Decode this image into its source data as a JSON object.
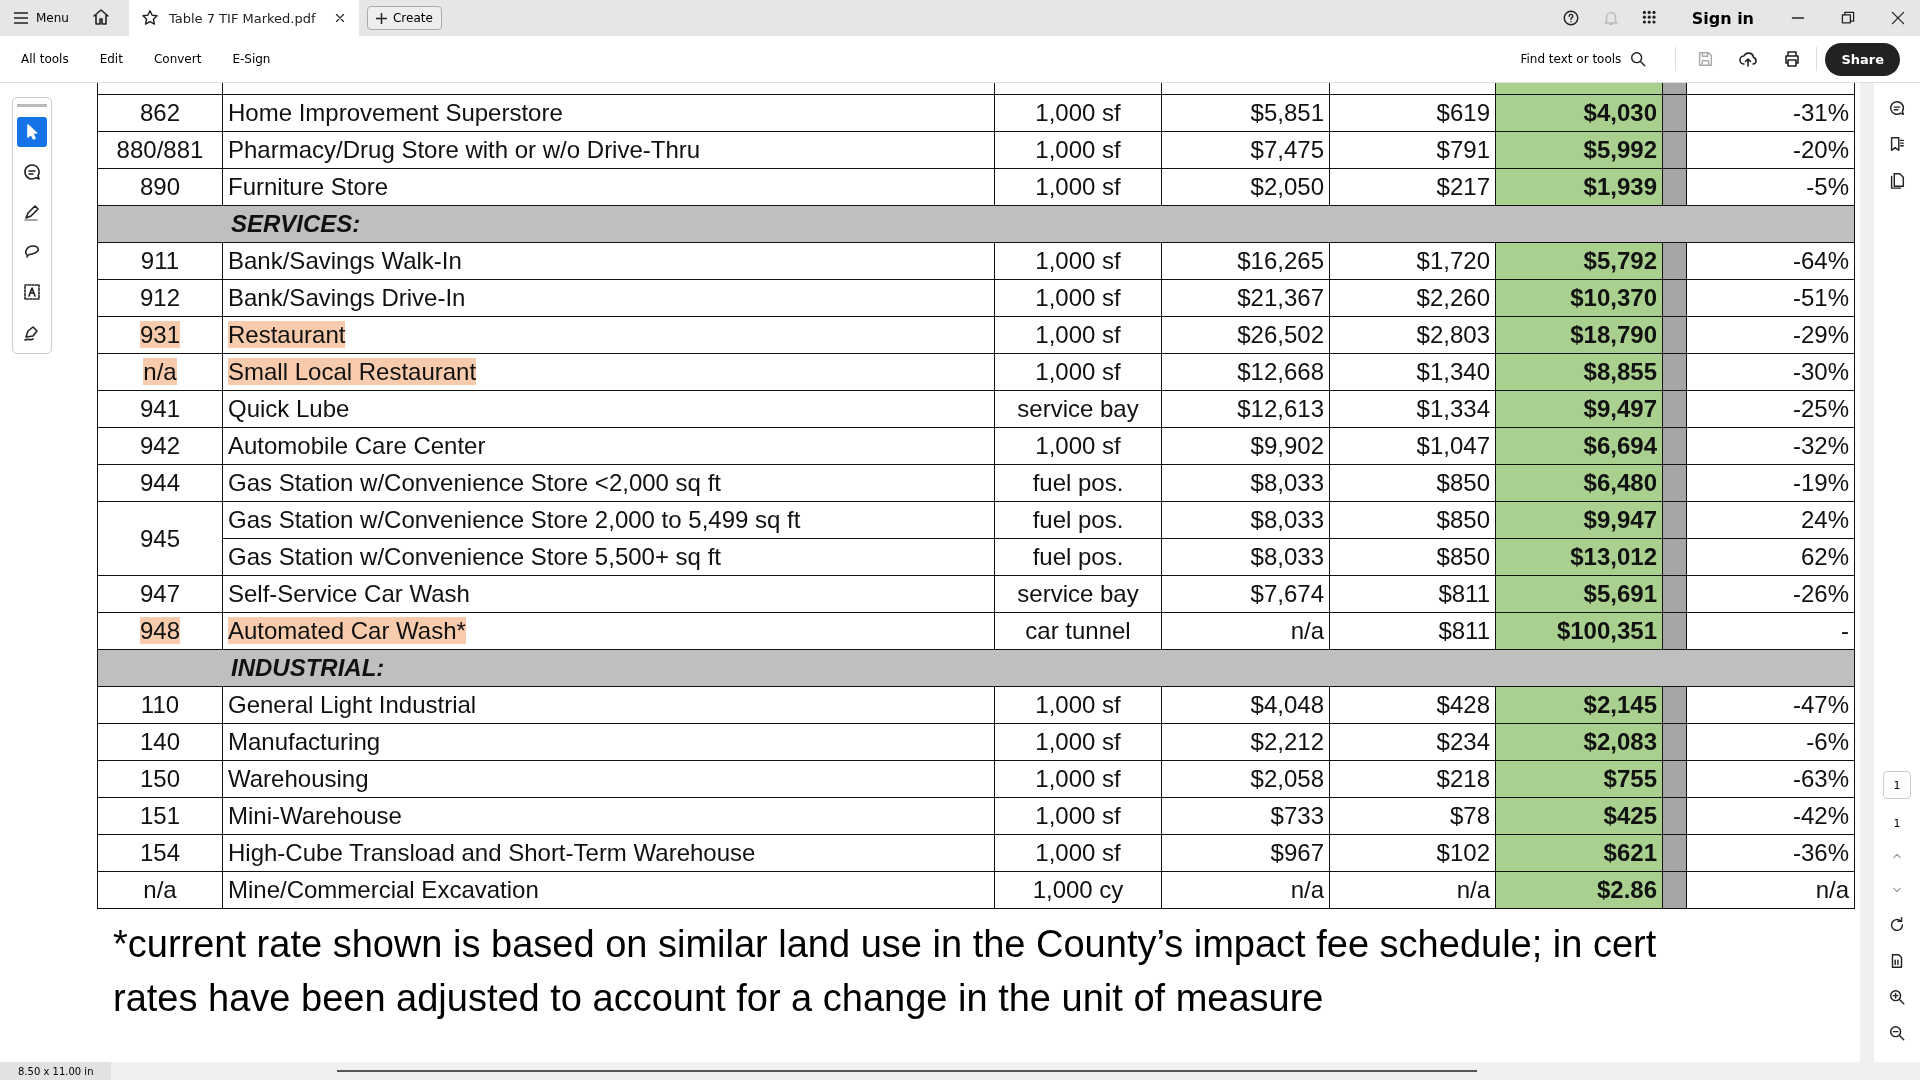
{
  "titlebar": {
    "menu": "Menu",
    "tab": {
      "title": "Table 7 TIF Marked.pdf",
      "selected": true
    },
    "create": "Create",
    "sign_in": "Sign in"
  },
  "toolbar": {
    "items": [
      "All tools",
      "Edit",
      "Convert",
      "E-Sign"
    ],
    "search": "Find text or tools",
    "share": "Share"
  },
  "rail_tools": [
    {
      "kind": "select",
      "selected": true
    },
    {
      "kind": "comment",
      "selected": false
    },
    {
      "kind": "draw",
      "selected": false
    },
    {
      "kind": "lasso",
      "selected": false
    },
    {
      "kind": "text",
      "selected": false
    },
    {
      "kind": "sign",
      "selected": false
    }
  ],
  "table": {
    "rows": [
      {
        "kind": "row",
        "code": "862",
        "description": "Home Improvement Superstore",
        "unit": "1,000 sf",
        "column_4": "$5,851",
        "column_5": "$619",
        "column_6": "$4,030",
        "column_8": "-31%",
        "highlighted": false
      },
      {
        "kind": "row",
        "code": "880/881",
        "description": "Pharmacy/Drug Store with or w/o Drive-Thru",
        "unit": "1,000 sf",
        "column_4": "$7,475",
        "column_5": "$791",
        "column_6": "$5,992",
        "column_8": "-20%",
        "highlighted": false
      },
      {
        "kind": "row",
        "code": "890",
        "description": "Furniture Store",
        "unit": "1,000 sf",
        "column_4": "$2,050",
        "column_5": "$217",
        "column_6": "$1,939",
        "column_8": "-5%",
        "highlighted": false
      },
      {
        "kind": "section",
        "title": "SERVICES:"
      },
      {
        "kind": "row",
        "code": "911",
        "description": "Bank/Savings Walk-In",
        "unit": "1,000 sf",
        "column_4": "$16,265",
        "column_5": "$1,720",
        "column_6": "$5,792",
        "column_8": "-64%",
        "highlighted": false
      },
      {
        "kind": "row",
        "code": "912",
        "description": "Bank/Savings Drive-In",
        "unit": "1,000 sf",
        "column_4": "$21,367",
        "column_5": "$2,260",
        "column_6": "$10,370",
        "column_8": "-51%",
        "highlighted": false
      },
      {
        "kind": "row",
        "code": "931",
        "description": "Restaurant",
        "unit": "1,000 sf",
        "column_4": "$26,502",
        "column_5": "$2,803",
        "column_6": "$18,790",
        "column_8": "-29%",
        "highlighted": true
      },
      {
        "kind": "row",
        "code": "n/a",
        "description": "Small Local Restaurant",
        "unit": "1,000 sf",
        "column_4": "$12,668",
        "column_5": "$1,340",
        "column_6": "$8,855",
        "column_8": "-30%",
        "highlighted": true
      },
      {
        "kind": "row",
        "code": "941",
        "description": "Quick Lube",
        "unit": "service bay",
        "column_4": "$12,613",
        "column_5": "$1,334",
        "column_6": "$9,497",
        "column_8": "-25%",
        "highlighted": false
      },
      {
        "kind": "row",
        "code": "942",
        "description": "Automobile Care Center",
        "unit": "1,000 sf",
        "column_4": "$9,902",
        "column_5": "$1,047",
        "column_6": "$6,694",
        "column_8": "-32%",
        "highlighted": false
      },
      {
        "kind": "row",
        "code": "944",
        "description": "Gas Station w/Convenience Store <2,000 sq ft",
        "unit": "fuel pos.",
        "column_4": "$8,033",
        "column_5": "$850",
        "column_6": "$6,480",
        "column_8": "-19%",
        "highlighted": false
      },
      {
        "kind": "group",
        "code": "945",
        "highlighted": false,
        "lines": [
          {
            "description": "Gas Station w/Convenience Store 2,000 to 5,499 sq ft",
            "unit": "fuel pos.",
            "column_4": "$8,033",
            "column_5": "$850",
            "column_6": "$9,947",
            "column_8": "24%"
          },
          {
            "description": "Gas Station w/Convenience Store 5,500+ sq ft",
            "unit": "fuel pos.",
            "column_4": "$8,033",
            "column_5": "$850",
            "column_6": "$13,012",
            "column_8": "62%"
          }
        ]
      },
      {
        "kind": "row",
        "code": "947",
        "description": "Self-Service Car Wash",
        "unit": "service bay",
        "column_4": "$7,674",
        "column_5": "$811",
        "column_6": "$5,691",
        "column_8": "-26%",
        "highlighted": false
      },
      {
        "kind": "row",
        "code": "948",
        "description": "Automated Car Wash*",
        "unit": "car tunnel",
        "column_4": "n/a",
        "column_5": "$811",
        "column_6": "$100,351",
        "column_8": "-",
        "highlighted": true
      },
      {
        "kind": "section",
        "title": "INDUSTRIAL:"
      },
      {
        "kind": "row",
        "code": "110",
        "description": "General Light Industrial",
        "unit": "1,000 sf",
        "column_4": "$4,048",
        "column_5": "$428",
        "column_6": "$2,145",
        "column_8": "-47%",
        "highlighted": false
      },
      {
        "kind": "row",
        "code": "140",
        "description": "Manufacturing",
        "unit": "1,000 sf",
        "column_4": "$2,212",
        "column_5": "$234",
        "column_6": "$2,083",
        "column_8": "-6%",
        "highlighted": false
      },
      {
        "kind": "row",
        "code": "150",
        "description": "Warehousing",
        "unit": "1,000 sf",
        "column_4": "$2,058",
        "column_5": "$218",
        "column_6": "$755",
        "column_8": "-63%",
        "highlighted": false
      },
      {
        "kind": "row",
        "code": "151",
        "description": "Mini-Warehouse",
        "unit": "1,000 sf",
        "column_4": "$733",
        "column_5": "$78",
        "column_6": "$425",
        "column_8": "-42%",
        "highlighted": false
      },
      {
        "kind": "row",
        "code": "154",
        "description": "High-Cube Transload and Short-Term Warehouse",
        "unit": "1,000 sf",
        "column_4": "$967",
        "column_5": "$102",
        "column_6": "$621",
        "column_8": "-36%",
        "highlighted": false
      },
      {
        "kind": "row",
        "code": "n/a",
        "description": "Mine/Commercial Excavation",
        "unit": "1,000 cy",
        "column_4": "n/a",
        "column_5": "n/a",
        "column_6": "$2.86",
        "column_8": "n/a",
        "highlighted": false
      }
    ]
  },
  "footnote": [
    "*current rate shown is based on similar land use in the County’s impact fee schedule; in cert",
    "rates have been adjusted to account for a change in the unit of measure"
  ],
  "page_nav": {
    "current": "1",
    "total": "1"
  },
  "status_bar": {
    "page_size": "8.50 x 11.00 in"
  }
}
